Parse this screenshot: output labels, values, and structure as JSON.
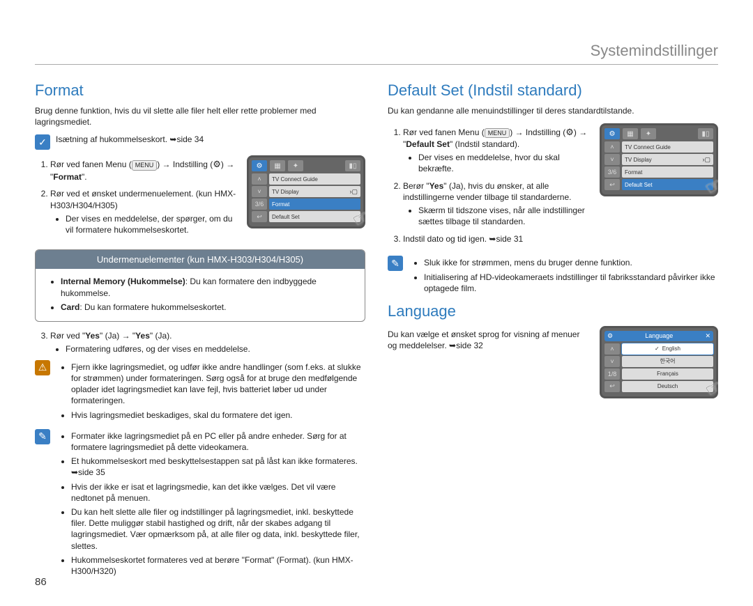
{
  "page": {
    "header": "Systemindstillinger",
    "number": "86"
  },
  "left": {
    "title": "Format",
    "intro": "Brug denne funktion, hvis du vil slette alle filer helt eller rette problemer med lagringsmediet.",
    "sd_note": "Isætning af hukommelseskort. ➥side 34",
    "step1_a": "Rør ved fanen Menu (",
    "menu_chip": "MENU",
    "step1_b": ") → Indstilling (",
    "step1_c": ") → \"",
    "step1_bold": "Format",
    "step1_d": "\".",
    "step2_a": "Rør ved et ønsket undermenuelement. (kun HMX-H303/H304/H305)",
    "step2_bullet": "Der vises en meddelelse, der spørger, om du vil formatere hukommelseskortet.",
    "subbox": {
      "header": "Undermenuelementer (kun HMX-H303/H304/H305)",
      "item1_strong": "Internal Memory (Hukommelse)",
      "item1_rest": ": Du kan formatere den indbyggede hukommelse.",
      "item2_strong": "Card",
      "item2_rest": ": Du kan formatere hukommelseskortet."
    },
    "step3_a": "Rør ved \"",
    "yes": "Yes",
    "step3_b": "\" (Ja) → \"",
    "step3_c": "\" (Ja).",
    "step3_bullet": "Formatering udføres, og der vises en meddelelse.",
    "warn": {
      "b1": "Fjern ikke lagringsmediet, og udfør ikke andre handlinger (som f.eks. at slukke for strømmen) under formateringen. Sørg også for at bruge den medfølgende oplader idet lagringsmediet kan lave fejl, hvis batteriet løber ud under formateringen.",
      "b2": "Hvis lagringsmediet beskadiges, skal du formatere det igen."
    },
    "notes": {
      "b1": "Formater ikke lagringsmediet på en PC eller på andre enheder. Sørg for at formatere lagringsmediet på dette videokamera.",
      "b2": "Et hukommelseskort med beskyttelsestappen sat på låst kan ikke formateres. ➥side 35",
      "b3": "Hvis der ikke er isat et lagringsmedie, kan det ikke vælges. Det vil være nedtonet på menuen.",
      "b4": "Du kan helt slette alle filer og indstillinger på lagringsmediet, inkl. beskyttede filer. Dette muliggør stabil hastighed og drift, når der skabes adgang til lagringsmediet. Vær opmærksom på, at alle filer og data, inkl. beskyttede filer, slettes.",
      "b5": "Hukommelseskortet formateres ved at berøre \"Format\" (Format). (kun HMX-H300/H320)"
    },
    "device": {
      "page_indicator": "3/6",
      "items": [
        "TV Connect Guide",
        "TV Display",
        "Format",
        "Default Set"
      ],
      "selected": "Format"
    }
  },
  "right": {
    "default_title": "Default Set (Indstil standard)",
    "default_intro": "Du kan gendanne alle menuindstillinger til deres standardtilstande.",
    "d_step1_a": "Rør ved fanen Menu (",
    "d_step1_b": ") → Indstilling (",
    "d_step1_c": ") → \"",
    "d_step1_bold": "Default Set",
    "d_step1_d": "\" (Indstil standard).",
    "d_step1_bullet": "Der vises en meddelelse, hvor du skal bekræfte.",
    "d_step2_a": "Berør \"",
    "d_step2_b": "\" (Ja), hvis du ønsker, at alle indstillingerne vender tilbage til standarderne.",
    "d_step2_bullet": "Skærm til tidszone vises, når alle indstillinger sættes tilbage til standarden.",
    "d_step3": "Indstil dato og tid igen. ➥side 31",
    "d_notes": {
      "b1": "Sluk ikke for strømmen, mens du bruger denne funktion.",
      "b2": "Initialisering af HD-videokameraets indstillinger til fabriksstandard påvirker ikke optagede film."
    },
    "d_device": {
      "page_indicator": "3/6",
      "items": [
        "TV Connect Guide",
        "TV Display",
        "Format",
        "Default Set"
      ],
      "selected": "Default Set"
    },
    "lang_title": "Language",
    "lang_intro": "Du kan vælge et ønsket sprog for visning af menuer og meddelelser. ➥side 32",
    "lang_device": {
      "title": "Language",
      "page_indicator": "1/8",
      "items": [
        "English",
        "한국어",
        "Français",
        "Deutsch"
      ],
      "selected": "English"
    }
  }
}
